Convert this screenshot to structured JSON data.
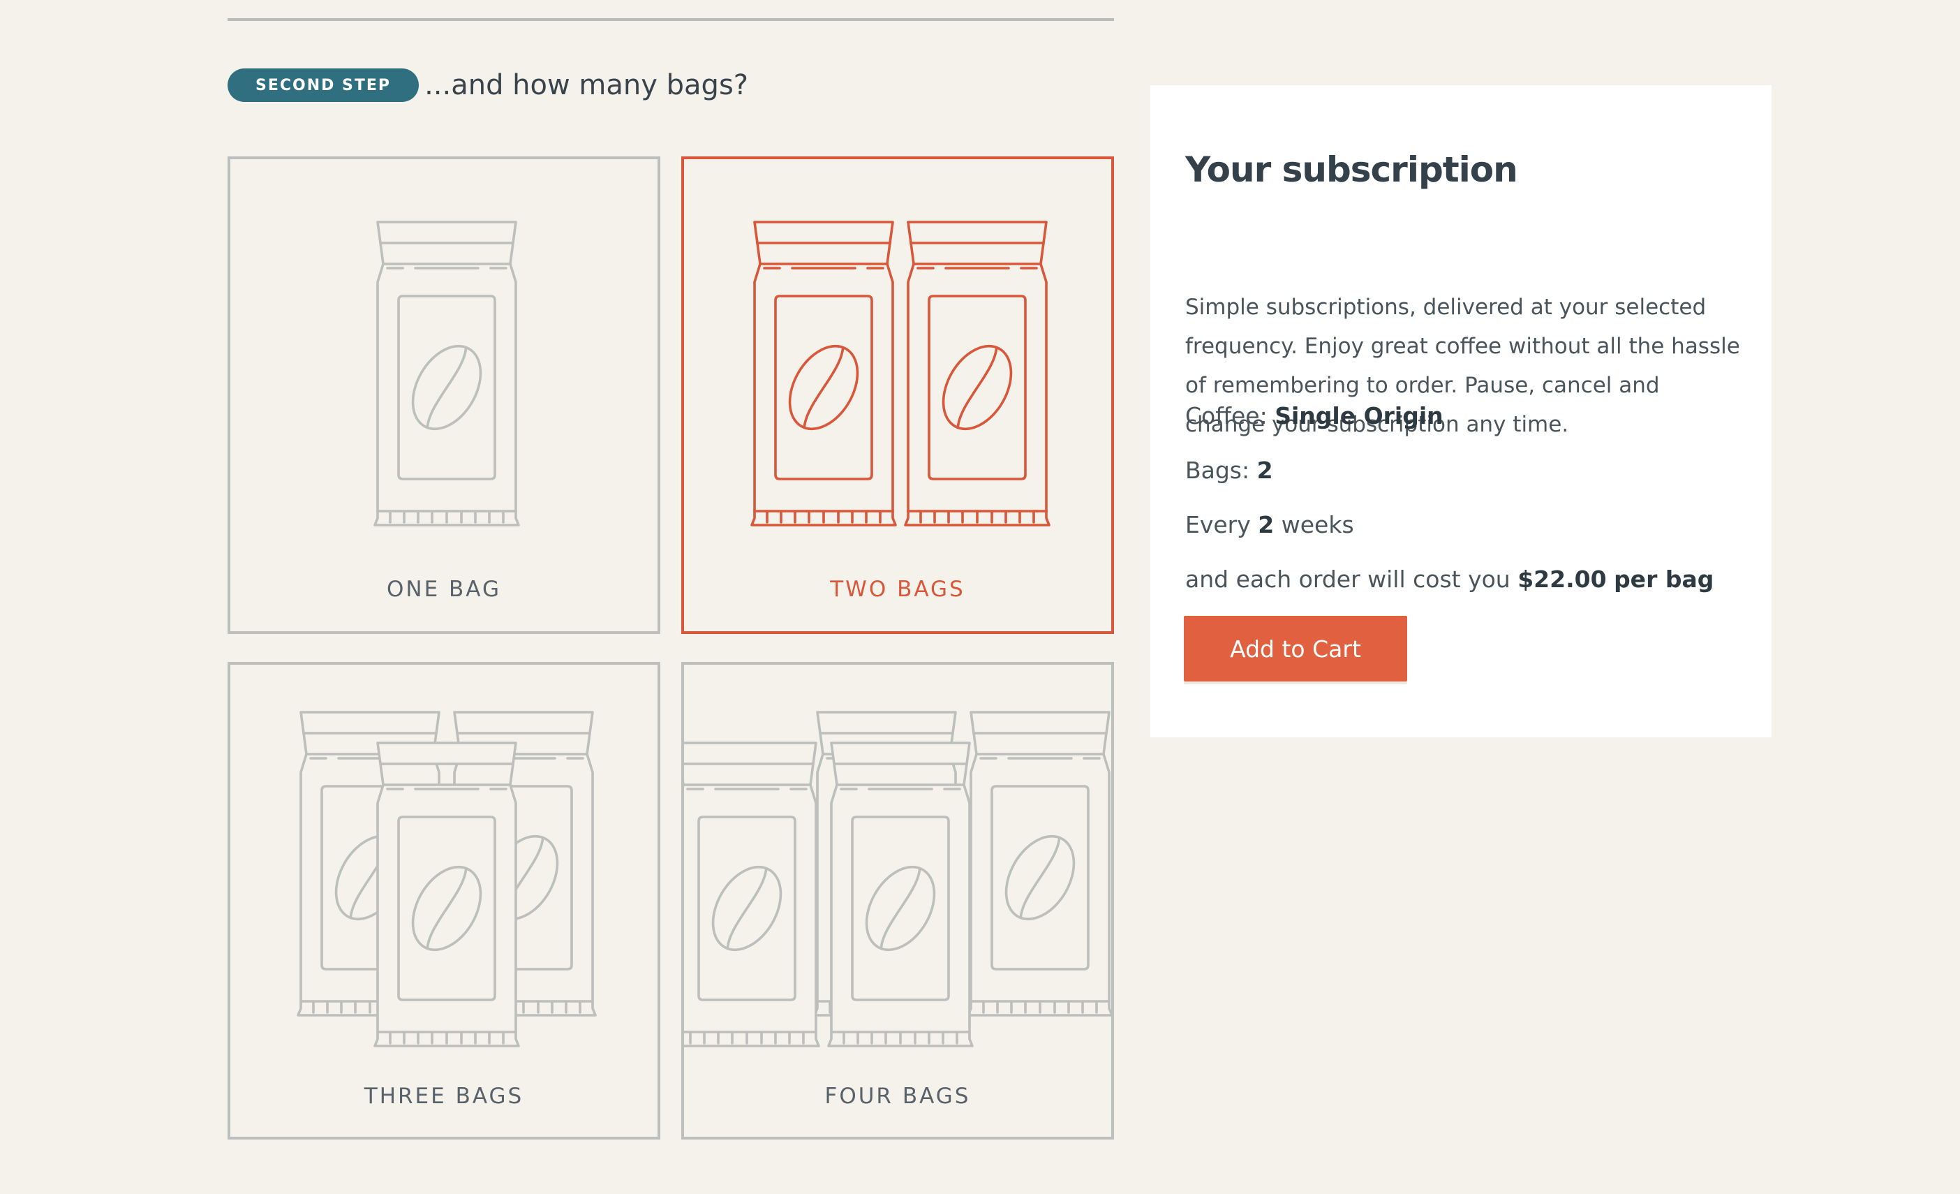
{
  "step": {
    "badge": "SECOND STEP",
    "question": "...and how many bags?"
  },
  "options": [
    {
      "label": "ONE BAG",
      "bags": 1,
      "selected": false
    },
    {
      "label": "TWO BAGS",
      "bags": 2,
      "selected": true
    },
    {
      "label": "THREE BAGS",
      "bags": 3,
      "selected": false
    },
    {
      "label": "FOUR BAGS",
      "bags": 4,
      "selected": false
    }
  ],
  "summary": {
    "title": "Your subscription",
    "description": "Simple subscriptions, delivered at your selected frequency. Enjoy great coffee without all the hassle of remembering to order. Pause, cancel and change your subscription any time.",
    "coffee_label": "Coffee:",
    "coffee_value": "Single Origin",
    "bags_label": "Bags:",
    "bags_value": "2",
    "every_label": "Every",
    "every_value": "2",
    "weeks_label": "weeks",
    "cost_label": "and each order will cost you",
    "cost_value": "$22.00",
    "cost_unit": "per bag",
    "button_label": "Add to Cart"
  },
  "colors": {
    "accent": "#d9573a",
    "badge": "#2f6f80",
    "outline": "#bdbfbd",
    "background": "#f4f2eb"
  },
  "icons": [
    "coffee-bag-icon"
  ]
}
